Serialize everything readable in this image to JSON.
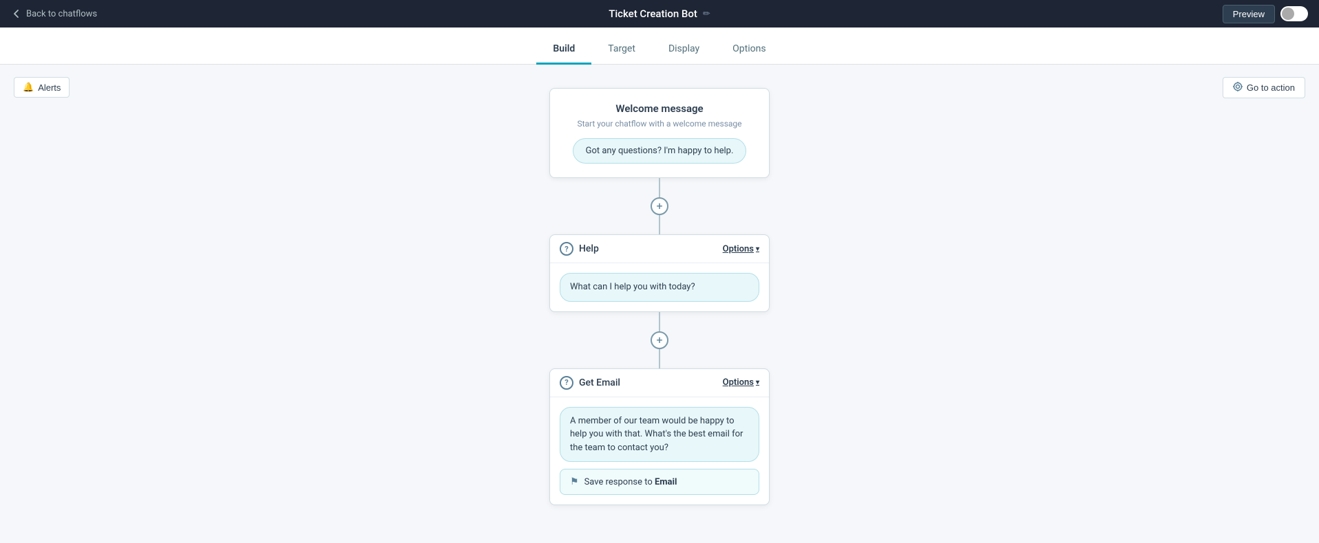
{
  "topbar": {
    "back_label": "Back to chatflows",
    "title": "Ticket Creation Bot",
    "edit_icon": "✏",
    "preview_label": "Preview"
  },
  "nav": {
    "tabs": [
      {
        "id": "build",
        "label": "Build",
        "active": true
      },
      {
        "id": "target",
        "label": "Target",
        "active": false
      },
      {
        "id": "display",
        "label": "Display",
        "active": false
      },
      {
        "id": "options",
        "label": "Options",
        "active": false
      }
    ]
  },
  "alerts_button": "Alerts",
  "go_to_action_button": "Go to action",
  "welcome": {
    "title": "Welcome message",
    "subtitle": "Start your chatflow with a welcome message",
    "bubble": "Got any questions? I'm happy to help."
  },
  "steps": [
    {
      "id": "help",
      "label": "Help",
      "options_label": "Options",
      "bubble": "What can I help you with today?"
    },
    {
      "id": "get-email",
      "label": "Get Email",
      "options_label": "Options",
      "bubble": "A member of our team would be happy to help you with that. What's the best email for the team to contact you?",
      "save_response": {
        "text_prefix": "Save response to ",
        "field": "Email"
      }
    }
  ],
  "connectors": [
    {
      "id": "plus-1"
    },
    {
      "id": "plus-2"
    }
  ]
}
